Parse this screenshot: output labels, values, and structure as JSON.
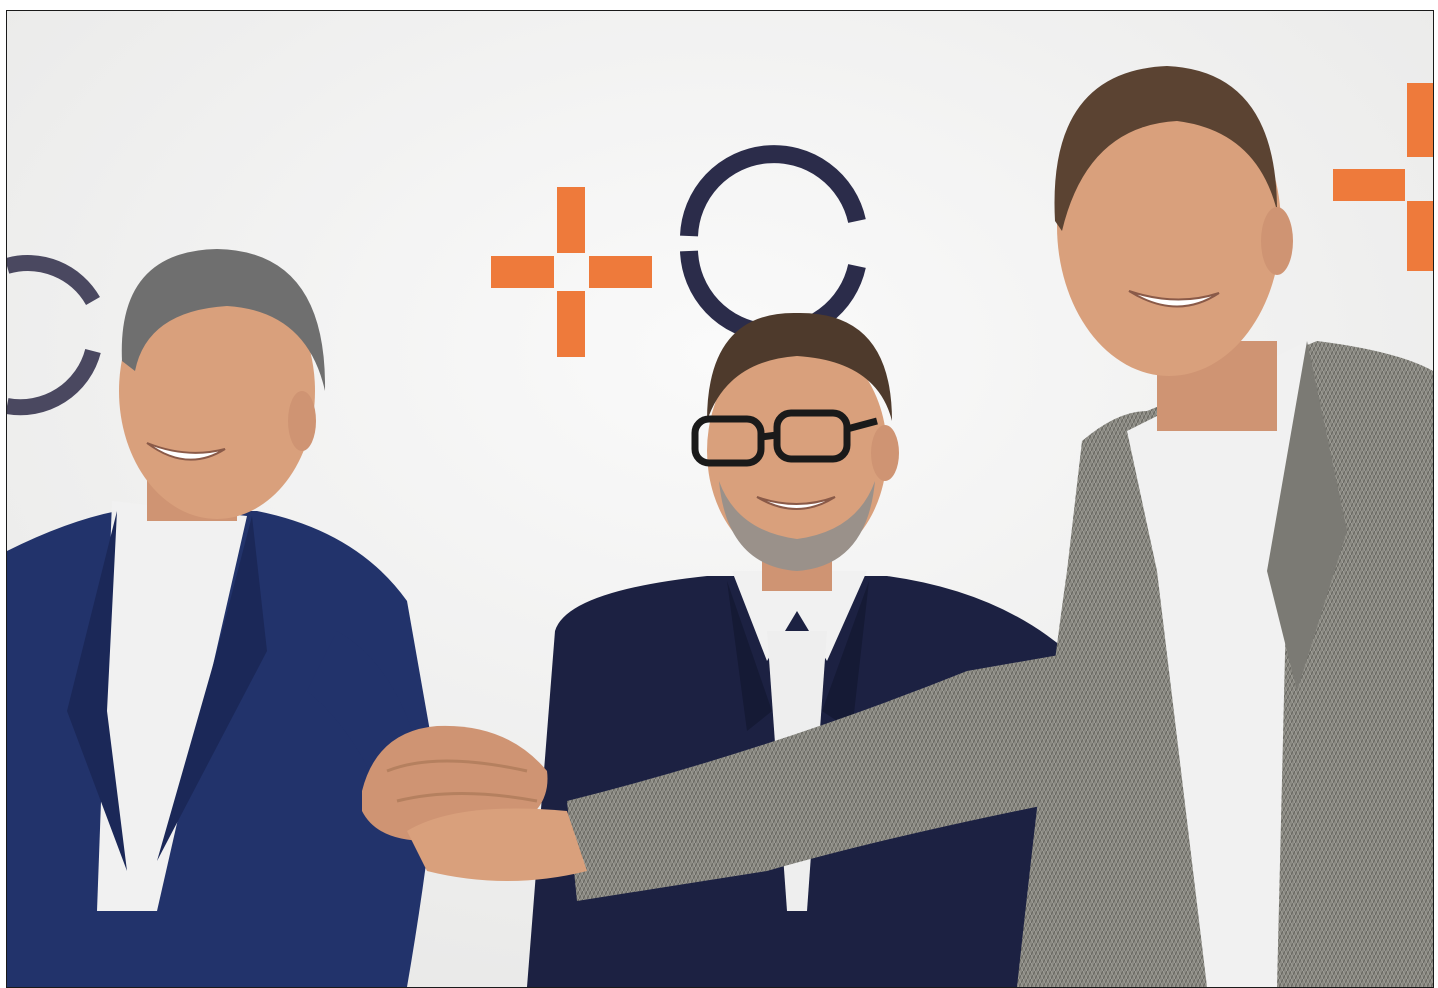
{
  "photo": {
    "colors": {
      "backdrop": "#f5f5f4",
      "logo_orange": "#ee7a3b",
      "logo_dark": "#2b2c4a",
      "logo_dark_left": "#4a4860",
      "navy_suit": "#22336b",
      "dark_navy_suit": "#1c2142",
      "tweed_suit": "#8c8b84",
      "shirt": "#f1f1f1",
      "skin": "#d9a07c",
      "hair_grey": "#6f6f6f",
      "hair_dark": "#4e3a2c",
      "hair_brown": "#5b4332",
      "glasses": "#1a1a1a"
    },
    "subjects": [
      {
        "name": "person-left",
        "attire": "navy-suit",
        "hair": "grey"
      },
      {
        "name": "person-middle",
        "attire": "dark-navy-suit",
        "hair": "dark",
        "accessory": "glasses"
      },
      {
        "name": "person-right",
        "attire": "herringbone-tweed-jacket",
        "hair": "brown"
      }
    ],
    "backdrop_logo": {
      "elements": [
        "plus-mark",
        "open-circle-mark"
      ]
    }
  }
}
